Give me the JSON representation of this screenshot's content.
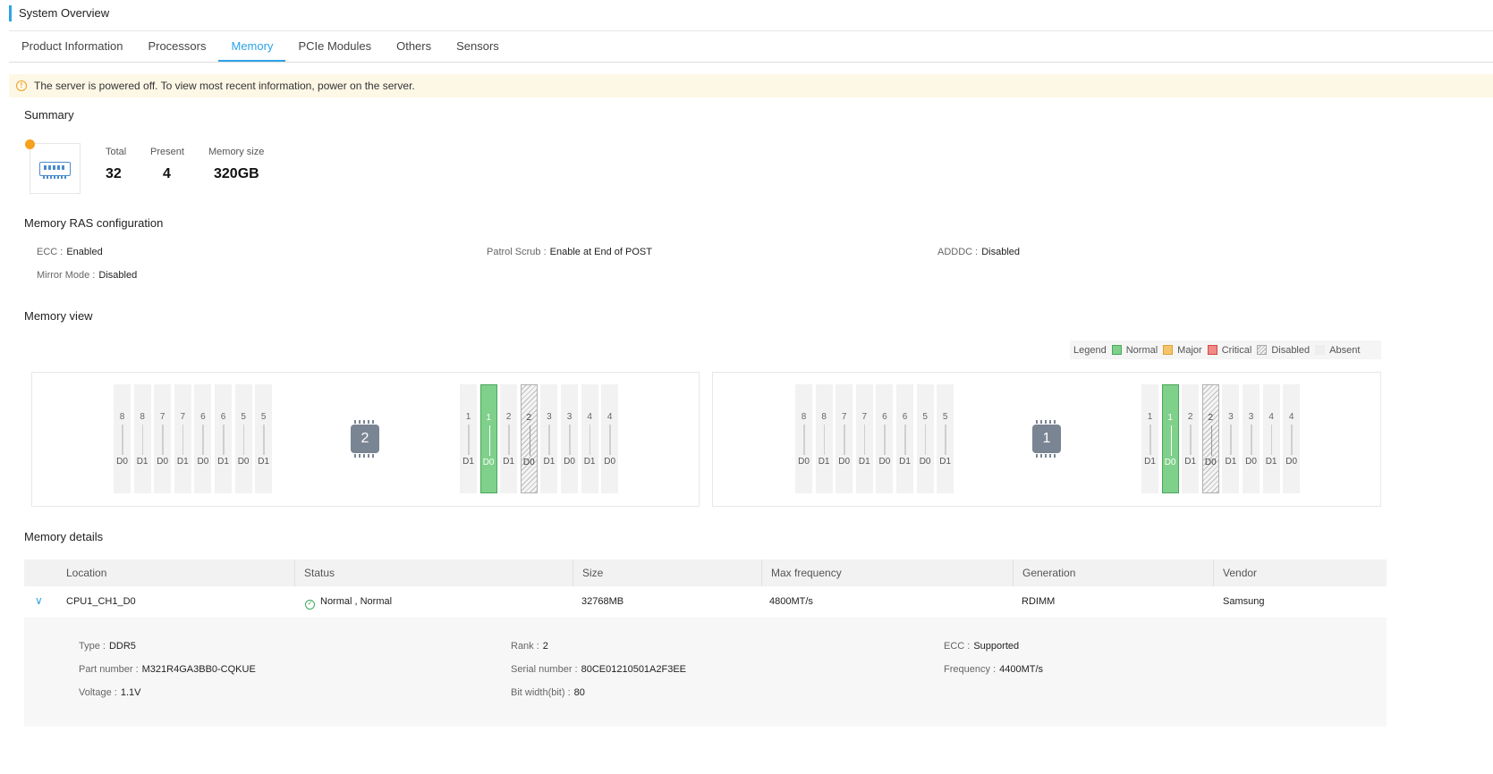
{
  "page_title": "System Overview",
  "tabs": [
    {
      "label": "Product Information"
    },
    {
      "label": "Processors"
    },
    {
      "label": "Memory",
      "active": true
    },
    {
      "label": "PCIe Modules"
    },
    {
      "label": "Others"
    },
    {
      "label": "Sensors"
    }
  ],
  "alert": {
    "text": "The server is powered off. To view most recent information, power on the server."
  },
  "summary": {
    "title": "Summary",
    "total_label": "Total",
    "total": "32",
    "present_label": "Present",
    "present": "4",
    "size_label": "Memory size",
    "size": "320GB"
  },
  "ras": {
    "title": "Memory RAS configuration",
    "ecc_label": "ECC :",
    "ecc": "Enabled",
    "patrol_label": "Patrol Scrub :",
    "patrol": "Enable at End of POST",
    "adddc_label": "ADDDC :",
    "adddc": "Disabled",
    "mirror_label": "Mirror Mode :",
    "mirror": "Disabled"
  },
  "memory_view": {
    "title": "Memory view",
    "legend": {
      "label": "Legend",
      "normal": "Normal",
      "major": "Major",
      "critical": "Critical",
      "disabled": "Disabled",
      "absent": "Absent"
    },
    "colors": {
      "normal": "#7fd08a",
      "major": "#f5c46a",
      "critical": "#f08a86",
      "disabled": "#cccccc",
      "absent": "#eeeeee"
    },
    "cpus": [
      {
        "id": "2",
        "left_slots": [
          {
            "num": "8",
            "dimm": "D0",
            "state": "absent"
          },
          {
            "num": "8",
            "dimm": "D1",
            "state": "absent"
          },
          {
            "num": "7",
            "dimm": "D0",
            "state": "absent"
          },
          {
            "num": "7",
            "dimm": "D1",
            "state": "absent"
          },
          {
            "num": "6",
            "dimm": "D0",
            "state": "absent"
          },
          {
            "num": "6",
            "dimm": "D1",
            "state": "absent"
          },
          {
            "num": "5",
            "dimm": "D0",
            "state": "absent"
          },
          {
            "num": "5",
            "dimm": "D1",
            "state": "absent"
          }
        ],
        "right_slots": [
          {
            "num": "1",
            "dimm": "D1",
            "state": "absent"
          },
          {
            "num": "1",
            "dimm": "D0",
            "state": "normal"
          },
          {
            "num": "2",
            "dimm": "D1",
            "state": "absent"
          },
          {
            "num": "2",
            "dimm": "D0",
            "state": "disabled"
          },
          {
            "num": "3",
            "dimm": "D1",
            "state": "absent"
          },
          {
            "num": "3",
            "dimm": "D0",
            "state": "absent"
          },
          {
            "num": "4",
            "dimm": "D1",
            "state": "absent"
          },
          {
            "num": "4",
            "dimm": "D0",
            "state": "absent"
          }
        ]
      },
      {
        "id": "1",
        "left_slots": [
          {
            "num": "8",
            "dimm": "D0",
            "state": "absent"
          },
          {
            "num": "8",
            "dimm": "D1",
            "state": "absent"
          },
          {
            "num": "7",
            "dimm": "D0",
            "state": "absent"
          },
          {
            "num": "7",
            "dimm": "D1",
            "state": "absent"
          },
          {
            "num": "6",
            "dimm": "D0",
            "state": "absent"
          },
          {
            "num": "6",
            "dimm": "D1",
            "state": "absent"
          },
          {
            "num": "5",
            "dimm": "D0",
            "state": "absent"
          },
          {
            "num": "5",
            "dimm": "D1",
            "state": "absent"
          }
        ],
        "right_slots": [
          {
            "num": "1",
            "dimm": "D1",
            "state": "absent"
          },
          {
            "num": "1",
            "dimm": "D0",
            "state": "normal"
          },
          {
            "num": "2",
            "dimm": "D1",
            "state": "absent"
          },
          {
            "num": "2",
            "dimm": "D0",
            "state": "disabled"
          },
          {
            "num": "3",
            "dimm": "D1",
            "state": "absent"
          },
          {
            "num": "3",
            "dimm": "D0",
            "state": "absent"
          },
          {
            "num": "4",
            "dimm": "D1",
            "state": "absent"
          },
          {
            "num": "4",
            "dimm": "D0",
            "state": "absent"
          }
        ]
      }
    ]
  },
  "details": {
    "title": "Memory details",
    "columns": [
      "Location",
      "Status",
      "Size",
      "Max frequency",
      "Generation",
      "Vendor"
    ],
    "row": {
      "location": "CPU1_CH1_D0",
      "status": "Normal , Normal",
      "size": "32768MB",
      "max_frequency": "4800MT/s",
      "generation": "RDIMM",
      "vendor": "Samsung"
    },
    "expanded": {
      "type_label": "Type :",
      "type": "DDR5",
      "part_label": "Part number :",
      "part": "M321R4GA3BB0-CQKUE",
      "voltage_label": "Voltage :",
      "voltage": "1.1V",
      "rank_label": "Rank :",
      "rank": "2",
      "serial_label": "Serial number :",
      "serial": "80CE01210501A2F3EE",
      "bitwidth_label": "Bit width(bit) :",
      "bitwidth": "80",
      "ecc_label": "ECC :",
      "ecc": "Supported",
      "freq_label": "Frequency :",
      "freq": "4400MT/s"
    }
  }
}
